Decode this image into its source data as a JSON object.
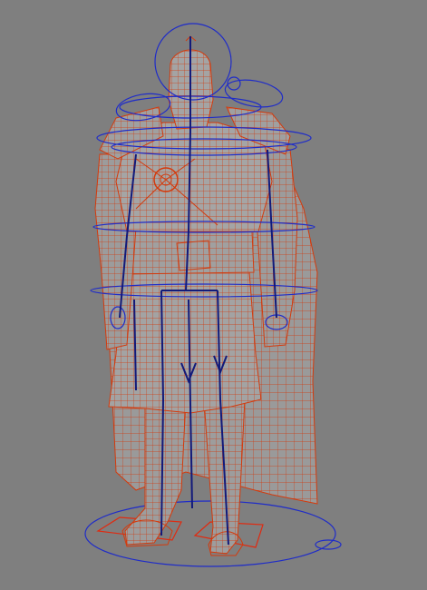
{
  "viewport": {
    "background_color": "#7f7f7f",
    "mesh_fill_color": "#9a9a9a",
    "wireframe_color": "#d43a0c",
    "control_curve_color": "#1f2cc8",
    "skeleton_color": "#121a7a"
  },
  "model": {
    "icon": "armored-warrior-character"
  }
}
